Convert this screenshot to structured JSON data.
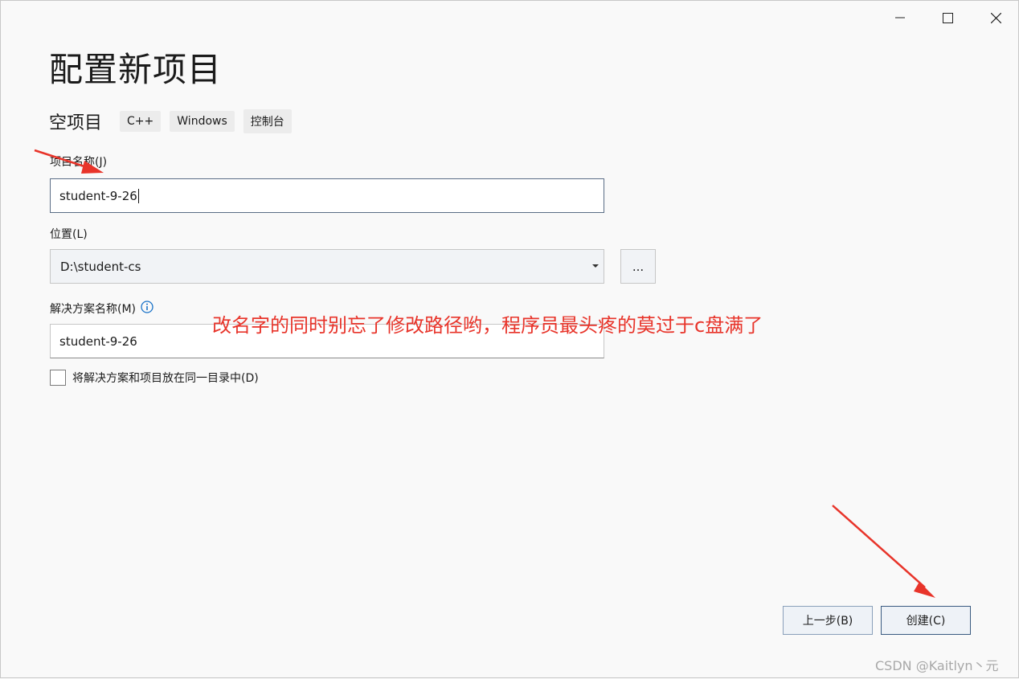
{
  "window": {
    "title": "配置新项目",
    "controls": {
      "minimize": "minimize-icon",
      "maximize": "maximize-icon",
      "close": "close-icon"
    }
  },
  "template": {
    "name": "空项目",
    "tags": [
      "C++",
      "Windows",
      "控制台"
    ]
  },
  "form": {
    "project_name_label": "项目名称(J)",
    "project_name_value": "student-9-26",
    "location_label": "位置(L)",
    "location_value": "D:\\student-cs",
    "browse_label": "...",
    "solution_name_label": "解决方案名称(M)",
    "solution_name_value": "student-9-26",
    "same_dir_label": "将解决方案和项目放在同一目录中(D)",
    "same_dir_checked": false
  },
  "footer": {
    "back_label": "上一步(B)",
    "create_label": "创建(C)"
  },
  "annotation": {
    "text": "改名字的同时别忘了修改路径哟，程序员最头疼的莫过于c盘满了",
    "color": "#e8342a"
  },
  "watermark": "CSDN @Kaitlyn丶元",
  "colors": {
    "info_icon": "#1a73c8",
    "annotation_arrow": "#e8342a"
  }
}
